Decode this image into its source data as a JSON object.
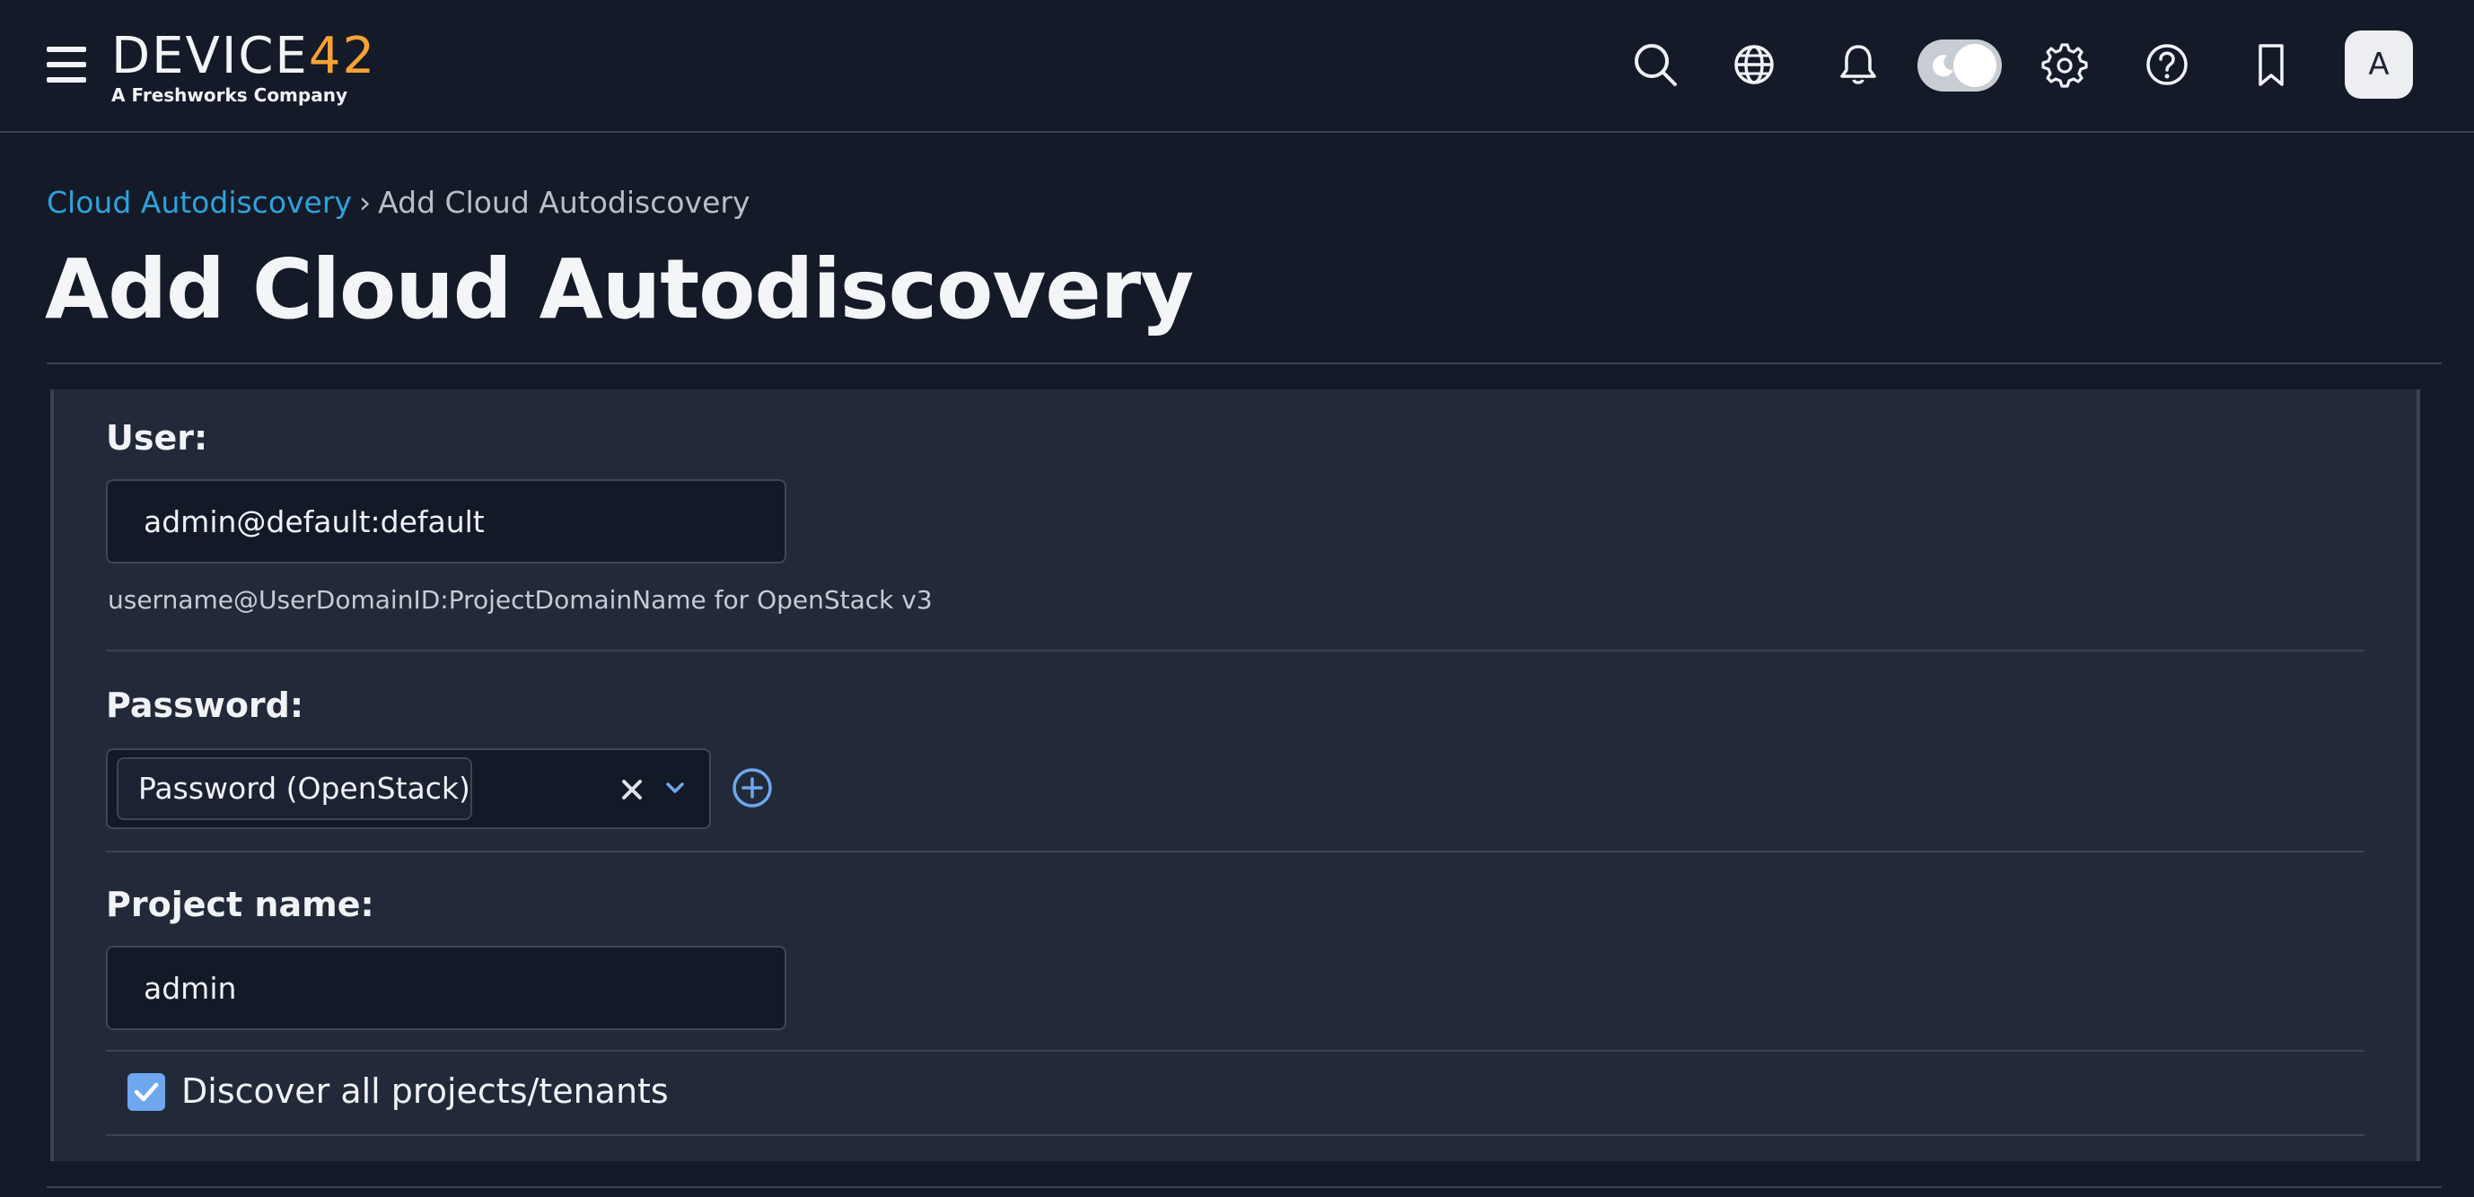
{
  "header": {
    "logo_text_main": "DEVICE",
    "logo_text_accent": "42",
    "logo_tagline": "A Freshworks Company",
    "icons": [
      "menu-icon",
      "search-icon",
      "globe-icon",
      "bell-icon",
      "theme-toggle",
      "gear-icon",
      "help-icon",
      "bookmark-icon"
    ],
    "avatar_initial": "A"
  },
  "breadcrumb": {
    "parent": "Cloud Autodiscovery",
    "separator": "›",
    "current": "Add Cloud Autodiscovery"
  },
  "page": {
    "title": "Add Cloud Autodiscovery"
  },
  "form": {
    "user": {
      "label": "User:",
      "value": "admin@default:default",
      "help": "username@UserDomainID:ProjectDomainName for OpenStack v3"
    },
    "password": {
      "label": "Password:",
      "selected": "Password (OpenStack)"
    },
    "project": {
      "label": "Project name:",
      "value": "admin"
    },
    "discover_all": {
      "label": "Discover all projects/tenants",
      "checked": true
    }
  },
  "colors": {
    "background": "#141a28",
    "panel": "#222a39",
    "link": "#2ea3dc",
    "logo_accent": "#f7a234",
    "checkbox": "#6ea7ee"
  }
}
